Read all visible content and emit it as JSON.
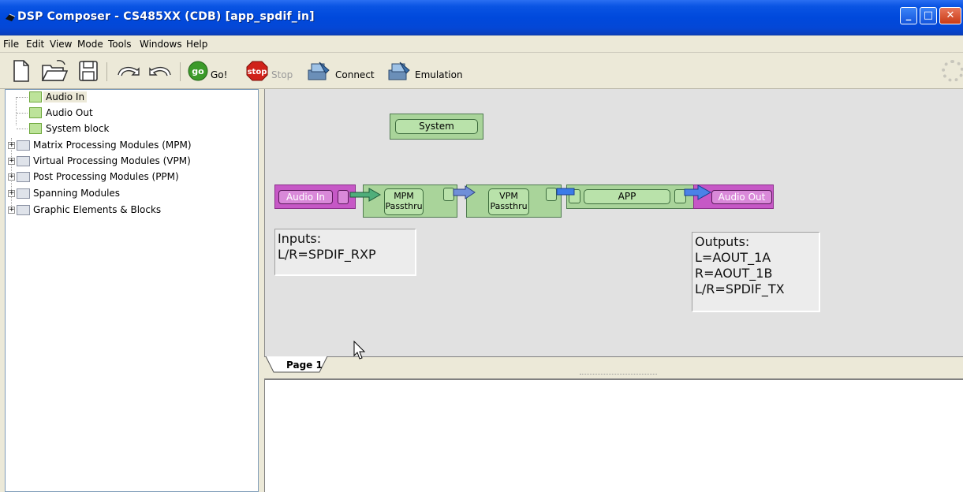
{
  "window": {
    "title": "DSP Composer - CS485XX (CDB) [app_spdif_in]",
    "min_glyph": "_",
    "max_glyph": "□",
    "close_glyph": "✕"
  },
  "menu": [
    "File",
    "Edit",
    "View",
    "Mode",
    "Tools",
    "Windows",
    "Help"
  ],
  "toolbar": {
    "go_badge": "go",
    "go_label": "Go!",
    "stop_badge": "stop",
    "stop_label": "Stop",
    "connect_label": "Connect",
    "emulation_label": "Emulation"
  },
  "tree": {
    "items": [
      {
        "label": "Audio In",
        "type": "leaf",
        "selected": true
      },
      {
        "label": "Audio Out",
        "type": "leaf"
      },
      {
        "label": "System block",
        "type": "leaf"
      },
      {
        "label": "Matrix Processing Modules (MPM)",
        "type": "folder"
      },
      {
        "label": "Virtual Processing Modules (VPM)",
        "type": "folder"
      },
      {
        "label": "Post Processing Modules (PPM)",
        "type": "folder"
      },
      {
        "label": "Spanning Modules",
        "type": "folder"
      },
      {
        "label": "Graphic Elements & Blocks",
        "type": "folder"
      }
    ],
    "expander_glyph": "+"
  },
  "diagram": {
    "system_label": "System",
    "audio_in_label": "Audio In",
    "mpm_line1": "MPM",
    "mpm_line2": "Passthru",
    "vpm_line1": "VPM",
    "vpm_line2": "Passthru",
    "app_label": "APP",
    "audio_out_label": "Audio Out",
    "inputs_title": "Inputs:",
    "inputs_line1": "L/R=SPDIF_RXP",
    "outputs_title": "Outputs:",
    "outputs_line1": "L=AOUT_1A",
    "outputs_line2": "R=AOUT_1B",
    "outputs_line3": "L/R=SPDIF_TX"
  },
  "tabs": {
    "page1": "Page 1"
  },
  "colors": {
    "titlebar": "#0a54e3",
    "module_green": "#a9d49a",
    "io_magenta": "#c658c6",
    "arrow_blue": "#4a82e8"
  }
}
